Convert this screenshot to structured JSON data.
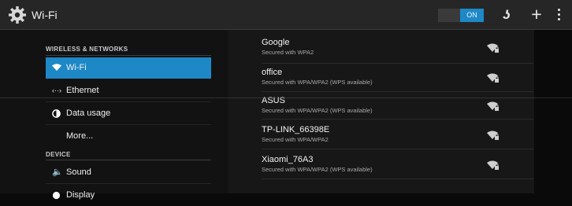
{
  "actionbar": {
    "title": "Wi-Fi",
    "toggle_label": "ON",
    "icons": [
      "settings-gear-icon",
      "wps-icon",
      "add-network-icon",
      "overflow-menu-icon"
    ]
  },
  "sidebar": {
    "sections": [
      {
        "label": "WIRELESS & NETWORKS"
      },
      {
        "label": "DEVICE"
      }
    ],
    "items": [
      {
        "label": "Wi-Fi",
        "icon": "wifi-icon",
        "selected": true
      },
      {
        "label": "Ethernet",
        "icon": "ethernet-icon"
      },
      {
        "label": "Data usage",
        "icon": "data-usage-icon"
      },
      {
        "label": "More..."
      },
      {
        "label": "Sound",
        "icon": "speaker-icon"
      },
      {
        "label": "Display",
        "icon": "display-icon"
      }
    ]
  },
  "networks": [
    {
      "ssid": "Google",
      "security": "Secured with WPA2",
      "icon": "wifi-lock-icon"
    },
    {
      "ssid": "office",
      "security": "Secured with WPA/WPA2 (WPS available)",
      "icon": "wifi-lock-icon"
    },
    {
      "ssid": "ASUS",
      "security": "Secured with WPA/WPA2 (WPS available)",
      "icon": "wifi-lock-icon"
    },
    {
      "ssid": "TP-LINK_66398E",
      "security": "Secured with WPA/WPA2",
      "icon": "wifi-lock-icon"
    },
    {
      "ssid": "Xiaomi_76A3",
      "security": "Secured with WPA/WPA2 (WPS available)",
      "icon": "wifi-lock-icon"
    }
  ],
  "colors": {
    "accent": "#1e88c7",
    "background": "#0a0a0a",
    "panel": "#171717"
  }
}
